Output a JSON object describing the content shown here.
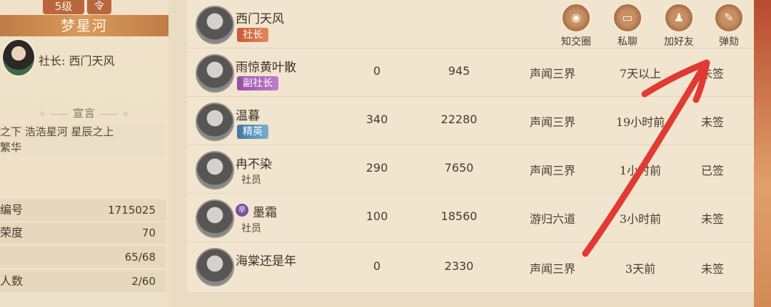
{
  "sidebar": {
    "level": "5级",
    "level_icon": "令",
    "club_name": "梦星河",
    "leader": "社长: 西门天风",
    "declaration_title": "宣言",
    "declaration_text": "之下 浩浩星河 星辰之上\n繁华",
    "stats": [
      {
        "label": "编号",
        "value": "1715025"
      },
      {
        "label": "荣度",
        "value": "70"
      },
      {
        "label": "",
        "value": "65/68"
      },
      {
        "label": "人数",
        "value": "2/60"
      }
    ]
  },
  "actions": [
    {
      "label": "知交圈",
      "icon": "circle-icon"
    },
    {
      "label": "私聊",
      "icon": "chat-icon"
    },
    {
      "label": "加好友",
      "icon": "add-friend-icon"
    },
    {
      "label": "弹劾",
      "icon": "impeach-icon"
    }
  ],
  "members": [
    {
      "name": "西门天风",
      "role": "社长",
      "role_type": "leader"
    },
    {
      "name": "雨惊黄叶散",
      "role": "副社长",
      "role_type": "vice",
      "c1": "0",
      "c2": "945",
      "c3": "声闻三界",
      "c4": "7天以上",
      "c5": "未签"
    },
    {
      "name": "温暮",
      "role": "精英",
      "role_type": "elite",
      "c1": "340",
      "c2": "22280",
      "c3": "声闻三界",
      "c4": "19小时前",
      "c5": "未签"
    },
    {
      "name": "冉不染",
      "role": "社员",
      "role_type": "member",
      "c1": "290",
      "c2": "7650",
      "c3": "声闻三界",
      "c4": "1小时前",
      "c5": "已签"
    },
    {
      "name": "墨霜",
      "role": "社员",
      "role_type": "member",
      "tag": "辛",
      "c1": "100",
      "c2": "18560",
      "c3": "游归六道",
      "c4": "3小时前",
      "c5": "未签"
    },
    {
      "name": "海棠还是年",
      "role": "",
      "role_type": "none",
      "c1": "0",
      "c2": "2330",
      "c3": "声闻三界",
      "c4": "3天前",
      "c5": "未签"
    }
  ],
  "colors": {
    "annotation_arrow": "#e03a32",
    "leader_badge": "#c95a3a",
    "vice_badge": "#9a4da6",
    "elite_badge": "#3d79a8"
  }
}
